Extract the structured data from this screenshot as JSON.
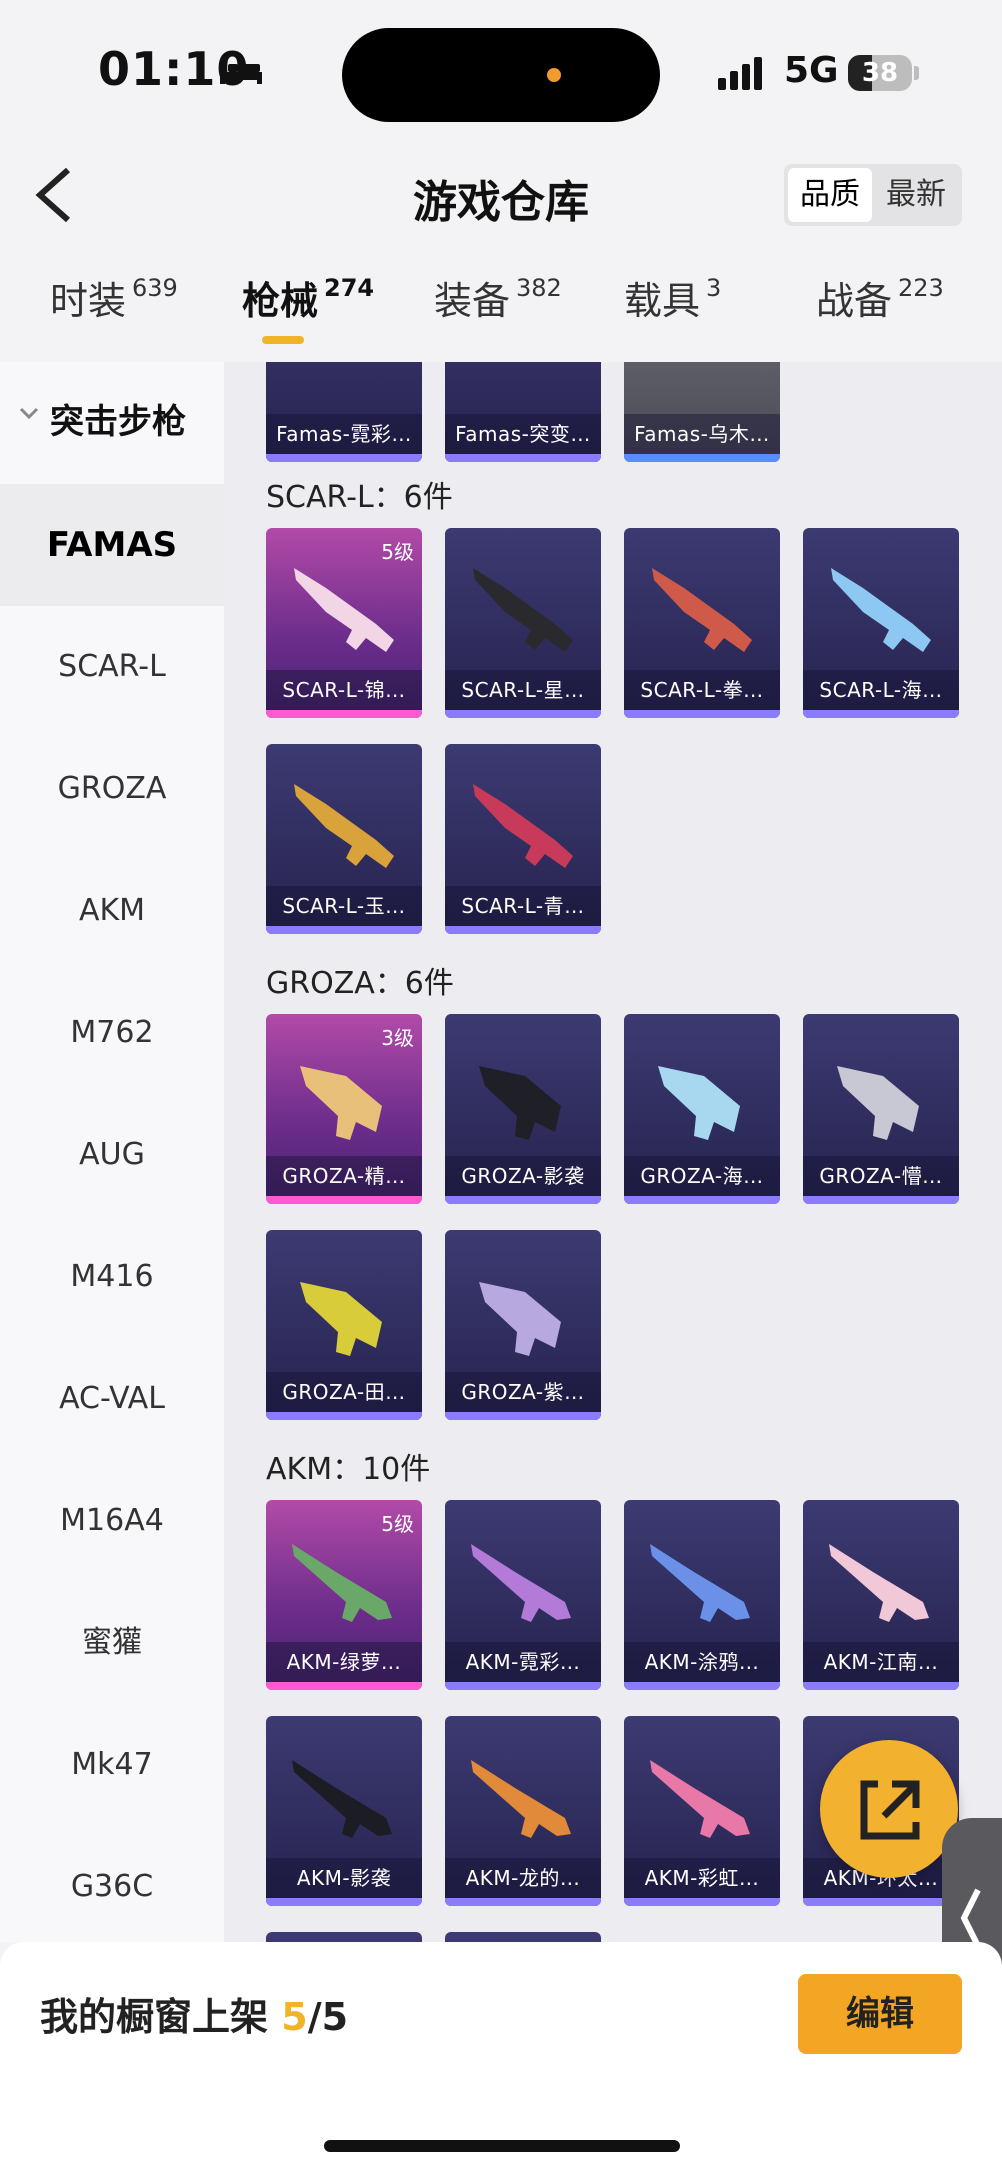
{
  "status_bar": {
    "time": "01:10",
    "network": "5G",
    "battery": "38",
    "battery_level": 0.38
  },
  "header": {
    "title": "游戏仓库",
    "sort_options": [
      "品质",
      "最新"
    ]
  },
  "tabs": [
    {
      "label": "时装",
      "count": "639"
    },
    {
      "label": "枪械",
      "count": "274"
    },
    {
      "label": "装备",
      "count": "382"
    },
    {
      "label": "载具",
      "count": "3"
    },
    {
      "label": "战备",
      "count": "223"
    }
  ],
  "sidebar": {
    "group": "突击步枪",
    "items": [
      "FAMAS",
      "SCAR-L",
      "GROZA",
      "AKM",
      "M762",
      "AUG",
      "M416",
      "AC-VAL",
      "M16A4",
      "蜜獾",
      "Mk47",
      "G36C"
    ]
  },
  "content": {
    "top_cards": [
      "Famas-霓彩…",
      "Famas-突变…",
      "Famas-乌木…"
    ],
    "sections": [
      {
        "title": "SCAR-L：6件",
        "cards": [
          {
            "label": "SCAR-L-锦…",
            "level": "5级"
          },
          {
            "label": "SCAR-L-星…"
          },
          {
            "label": "SCAR-L-拳…"
          },
          {
            "label": "SCAR-L-海…"
          },
          {
            "label": "SCAR-L-玉…"
          },
          {
            "label": "SCAR-L-青…"
          }
        ]
      },
      {
        "title": "GROZA：6件",
        "cards": [
          {
            "label": "GROZA-精…",
            "level": "3级"
          },
          {
            "label": "GROZA-影袭"
          },
          {
            "label": "GROZA-海…"
          },
          {
            "label": "GROZA-懵…"
          },
          {
            "label": "GROZA-田…"
          },
          {
            "label": "GROZA-紫…"
          }
        ]
      },
      {
        "title": "AKM：10件",
        "cards": [
          {
            "label": "AKM-绿萝…",
            "level": "5级"
          },
          {
            "label": "AKM-霓彩…"
          },
          {
            "label": "AKM-涂鸦…"
          },
          {
            "label": "AKM-江南…"
          },
          {
            "label": "AKM-影袭"
          },
          {
            "label": "AKM-龙的…"
          },
          {
            "label": "AKM-彩虹…"
          },
          {
            "label": "AKM-环太…"
          }
        ]
      }
    ]
  },
  "bottom": {
    "shelf_label": "我的橱窗上架",
    "shelf_count": "5",
    "shelf_total": "/5",
    "edit_label": "编辑"
  },
  "icons": {
    "back": "chevron-left-icon",
    "share": "external-link-icon",
    "side_tab": "chevron-left-icon",
    "bed": "bed-icon",
    "signal": "signal-icon"
  },
  "colors": {
    "accent": "#f0b429",
    "button": "#f2a623"
  }
}
